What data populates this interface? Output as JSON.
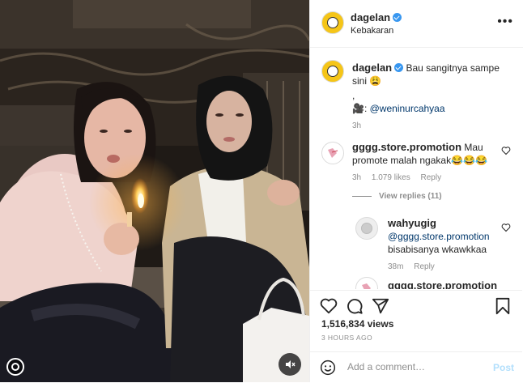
{
  "post": {
    "author": "dagelan",
    "location": "Kebakaran"
  },
  "caption": {
    "username": "dagelan",
    "text": "Bau sangitnya sampe sini",
    "emoji": "😩",
    "dot": ",",
    "credit_prefix": "🎥:",
    "credit_link": "@weninurcahyaa",
    "time": "3h"
  },
  "comments": [
    {
      "username": "gggg.store.promotion",
      "text": "Mau promote malah ngakak😂😂😂",
      "time": "3h",
      "likes": "1.079 likes",
      "reply": "Reply",
      "view_replies": "View replies (11)"
    },
    {
      "username": "wahyugig",
      "mention": "@gggg.store.promotion",
      "text": "bisabisanya wkawkkaa",
      "time": "38m",
      "reply": "Reply"
    },
    {
      "username": "gggg.store.promotion"
    }
  ],
  "stats": {
    "likes_count": "1,516,834 views",
    "posted_ago": "3 HOURS AGO"
  },
  "add_comment": {
    "placeholder": "Add a comment…",
    "post_label": "Post"
  },
  "icons": {
    "heart": "heart-icon",
    "comment": "comment-icon",
    "share": "share-icon",
    "save": "bookmark-icon",
    "mute": "mute-icon",
    "emoji": "smiley-icon",
    "more": "more-options-icon"
  }
}
